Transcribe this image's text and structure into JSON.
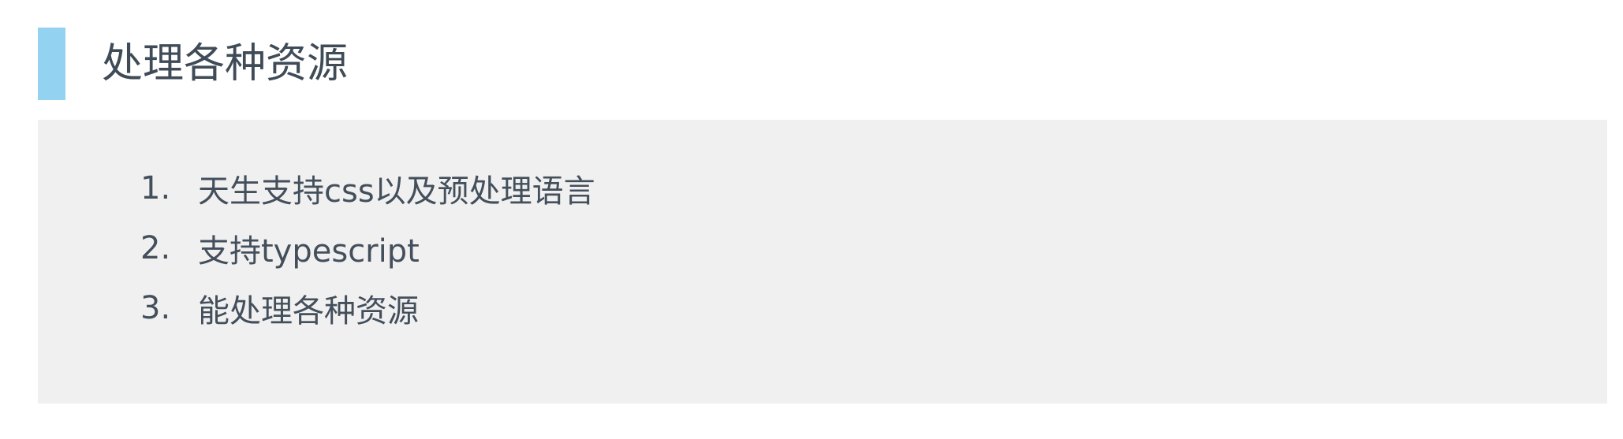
{
  "section": {
    "title": "处理各种资源",
    "accent_color": "#93d2f1"
  },
  "list": {
    "items": [
      {
        "number": "1.",
        "text": "天生支持css以及预处理语言"
      },
      {
        "number": "2.",
        "text": "支持typescript"
      },
      {
        "number": "3.",
        "text": "能处理各种资源"
      }
    ]
  }
}
